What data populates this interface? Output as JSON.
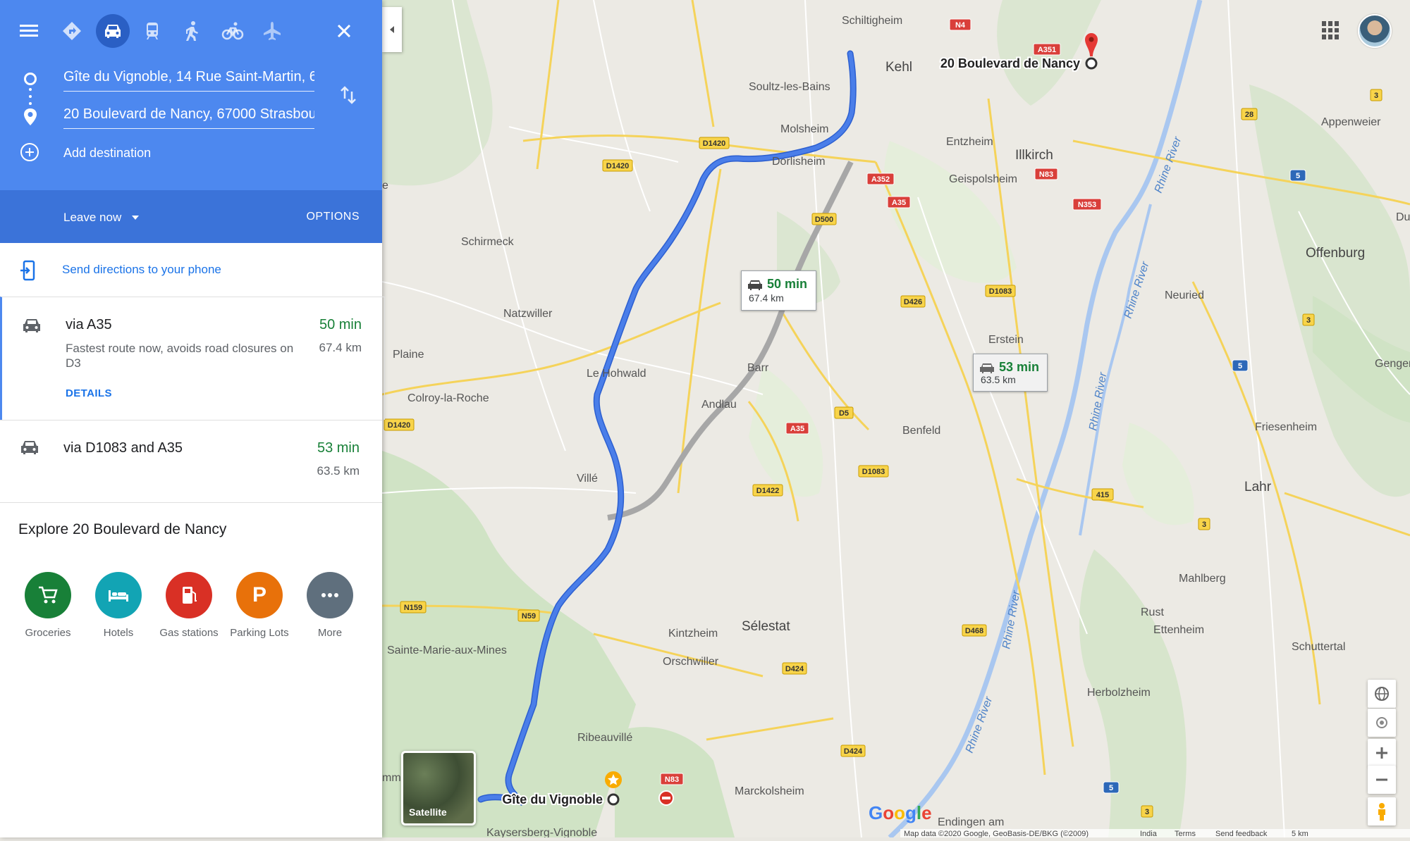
{
  "directions": {
    "origin": "Gîte du Vignoble, 14 Rue Saint-Martin, 6",
    "destination": "20 Boulevard de Nancy, 67000 Strasbou",
    "add_destination": "Add destination",
    "leave_now": "Leave now",
    "options": "OPTIONS",
    "send_to_phone": "Send directions to your phone",
    "modes": [
      "directions-icon",
      "car-icon",
      "transit-icon",
      "walk-icon",
      "bike-icon",
      "flight-icon"
    ]
  },
  "routes": [
    {
      "title": "via A35",
      "time": "50 min",
      "distance": "67.4 km",
      "description": "Fastest route now, avoids road closures on D3",
      "details": "DETAILS"
    },
    {
      "title": "via D1083 and A35",
      "time": "53 min",
      "distance": "63.5 km"
    }
  ],
  "explore": {
    "title": "Explore 20 Boulevard de Nancy",
    "items": [
      {
        "label": "Groceries",
        "color": "#188038",
        "icon": "cart-icon"
      },
      {
        "label": "Hotels",
        "color": "#12a4b4",
        "icon": "bed-icon"
      },
      {
        "label": "Gas stations",
        "color": "#d93025",
        "icon": "fuel-icon"
      },
      {
        "label": "Parking Lots",
        "color": "#e8710a",
        "icon": "parking-icon"
      },
      {
        "label": "More",
        "color": "#5f6f7d",
        "icon": "more-icon"
      }
    ]
  },
  "map": {
    "places": {
      "schiltigheim": "Schiltigheim",
      "kehl": "Kehl",
      "appenweier": "Appenweier",
      "soultz": "Soultz-les-Bains",
      "molsheim": "Molsheim",
      "entzheim": "Entzheim",
      "illkirch": "Illkirch",
      "dorlisheim": "Dorlisheim",
      "geispolsheim": "Geispolsheim",
      "schirmeck": "Schirmeck",
      "offenburg": "Offenburg",
      "du": "Du",
      "neuried": "Neuried",
      "natzwiller": "Natzwiller",
      "erstein": "Erstein",
      "plaine": "Plaine",
      "lehohwald": "Le Hohwald",
      "barr": "Barr",
      "genge": "Genger",
      "colroy": "Colroy-la-Roche",
      "andlau": "Andlau",
      "benfeld": "Benfeld",
      "friesenheim": "Friesenheim",
      "ville": "Villé",
      "lahr": "Lahr",
      "mahlberg": "Mahlberg",
      "kintzheim": "Kintzheim",
      "selestat": "Sélestat",
      "rust": "Rust",
      "ettenheim": "Ettenheim",
      "sainte_marie": "Sainte-Marie-aux-Mines",
      "orschwiller": "Orschwiller",
      "schuttertal": "Schuttertal",
      "herbolzheim": "Herbolzheim",
      "ribeauville": "Ribeauvillé",
      "marckolsheim": "Marckolsheim",
      "endingen": "Endingen am",
      "kaysersberg": "Kaysersberg-Vignoble",
      "mm": "mm",
      "e": "e"
    },
    "destination_label": "20 Boulevard de Nancy",
    "origin_label": "Gîte du Vignoble",
    "rhine": "Rhine River",
    "roads": {
      "n4": "N4",
      "a351": "A351",
      "a352": "A352",
      "a35": "A35",
      "n83": "N83",
      "n353": "N353",
      "d1420": "D1420",
      "d500": "D500",
      "d426": "D426",
      "d1083": "D1083",
      "d5": "D5",
      "d1422": "D1422",
      "n159": "N159",
      "n59": "N59",
      "d424": "D424",
      "d468": "D468",
      "r3": "3",
      "r28": "28",
      "r5": "5",
      "r415": "415"
    },
    "callout_main": {
      "time": "50 min",
      "distance": "67.4 km"
    },
    "callout_alt": {
      "time": "53 min",
      "distance": "63.5 km"
    },
    "satellite": "Satellite",
    "google": "Google",
    "footer": [
      "Map data ©2020 Google, GeoBasis-DE/BKG (©2009)",
      "India",
      "Terms",
      "Send feedback",
      "5 km"
    ],
    "colors": {
      "route_primary": "#4a7ee9",
      "route_alt": "#a7a7a7",
      "river": "#a9c7f0"
    }
  }
}
